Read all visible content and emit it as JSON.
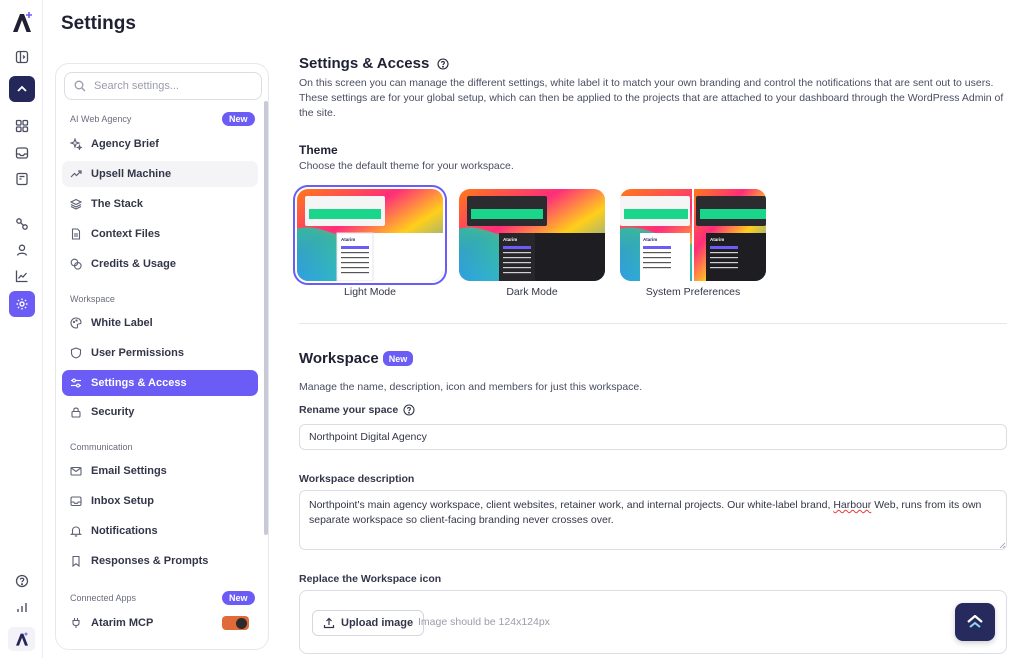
{
  "page_title": "Settings",
  "search": {
    "placeholder": "Search settings..."
  },
  "nav": {
    "sections": [
      {
        "label": "AI Web Agency",
        "badge": "New"
      },
      {
        "label": "Workspace"
      },
      {
        "label": "Communication"
      },
      {
        "label": "Connected Apps",
        "badge": "New"
      }
    ],
    "items": [
      {
        "label": "Agency Brief"
      },
      {
        "label": "Upsell Machine"
      },
      {
        "label": "The Stack"
      },
      {
        "label": "Context Files"
      },
      {
        "label": "Credits & Usage"
      },
      {
        "label": "White Label"
      },
      {
        "label": "User Permissions"
      },
      {
        "label": "Settings & Access"
      },
      {
        "label": "Security"
      },
      {
        "label": "Email Settings"
      },
      {
        "label": "Inbox Setup"
      },
      {
        "label": "Notifications"
      },
      {
        "label": "Responses & Prompts"
      },
      {
        "label": "Atarim MCP"
      }
    ]
  },
  "main": {
    "title": "Settings & Access",
    "intro": "On this screen you can manage the different settings, white label it to match your own branding and control the notifications that are sent out to users. These settings are for your global setup, which can then be applied to the projects that are attached to your dashboard through the WordPress Admin of the site.",
    "theme": {
      "heading": "Theme",
      "description": "Choose the default theme for your workspace.",
      "options": [
        {
          "label": "Light Mode",
          "selected": true
        },
        {
          "label": "Dark Mode",
          "selected": false
        },
        {
          "label": "System Preferences",
          "selected": false
        }
      ],
      "preview_brand": "Atarim"
    },
    "workspace": {
      "heading": "Workspace",
      "badge": "New",
      "description": "Manage the name, description, icon and members for just this workspace.",
      "rename_label": "Rename your space",
      "name_value": "Northpoint Digital Agency",
      "description_label": "Workspace description",
      "description_value_before": "Northpoint's main agency workspace, client websites, retainer work, and internal projects. Our white-label brand, ",
      "description_value_misspelled": "Harbour",
      "description_value_after": " Web, runs from its own separate workspace so client-facing branding never crosses over.",
      "icon_label": "Replace the Workspace icon",
      "upload_button": "Upload image",
      "upload_hint": "Image should be 124x124px"
    }
  },
  "colors": {
    "accent": "#6b5cf6",
    "navy": "#24275a",
    "text": "#1f2133"
  }
}
